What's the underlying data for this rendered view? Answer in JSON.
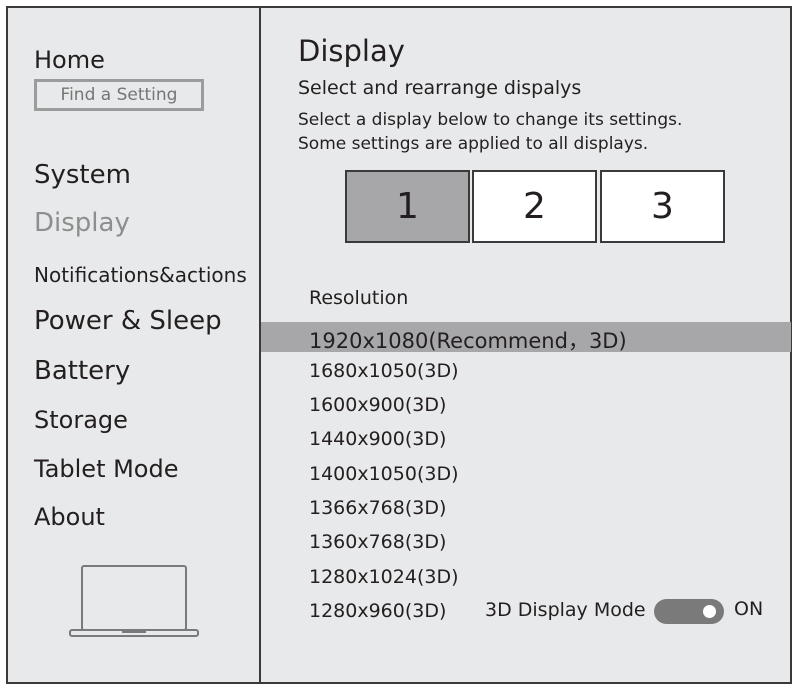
{
  "sidebar": {
    "home": "Home",
    "search_placeholder": "Find a Setting",
    "items": [
      {
        "label": "System"
      },
      {
        "label": "Display"
      },
      {
        "label": "Notifications&actions"
      },
      {
        "label": "Power & Sleep"
      },
      {
        "label": "Battery"
      },
      {
        "label": "Storage"
      },
      {
        "label": "Tablet Mode"
      },
      {
        "label": "About"
      }
    ]
  },
  "main": {
    "title": "Display",
    "subtitle": "Select and rearrange dispalys",
    "desc1": "Select a display below to change its settings.",
    "desc2": "Some settings are applied to all displays.",
    "monitors": [
      "1",
      "2",
      "3"
    ],
    "resolution_label": "Resolution",
    "resolutions": [
      "1920x1080(Recommend，3D)",
      "1680x1050(3D)",
      "1600x900(3D)",
      "1440x900(3D)",
      "1400x1050(3D)",
      "1366x768(3D)",
      "1360x768(3D)",
      "1280x1024(3D)",
      "1280x960(3D)"
    ],
    "mode_label": "3D Display Mode",
    "mode_state": "ON"
  }
}
